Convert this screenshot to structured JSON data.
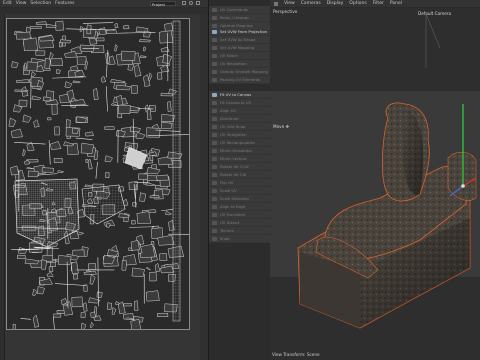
{
  "uv_editor": {
    "menu": [
      "Edit",
      "View",
      "Selection",
      "Features"
    ],
    "texture_select": "Project"
  },
  "commands": {
    "group1": [
      {
        "label": "UV Commands",
        "active": false
      },
      {
        "label": "Relax / Unwrap",
        "active": false
      },
      {
        "label": "Optimal Mapping",
        "active": false
      }
    ],
    "group2": [
      {
        "label": "Set UVW From Projection",
        "active": true
      },
      {
        "label": "Set UVW As Shape",
        "active": false
      },
      {
        "label": "Set UVW Mapping",
        "active": false
      },
      {
        "label": "UV Stitch",
        "active": false
      },
      {
        "label": "UV Relaxation",
        "active": false
      },
      {
        "label": "Unwrap Smooth Mapping",
        "active": false
      },
      {
        "label": "Packing UV Elements",
        "active": false
      }
    ],
    "group3": [
      {
        "label": "Fit UV to Canvas",
        "active": true
      },
      {
        "label": "Fit Canvas to UV",
        "active": false
      },
      {
        "label": "Align UV",
        "active": false
      },
      {
        "label": "Distribute",
        "active": false
      },
      {
        "label": "UV Grid Snap",
        "active": false
      },
      {
        "label": "UV Straighten",
        "active": false
      },
      {
        "label": "UV Rectangularize",
        "active": false
      },
      {
        "label": "Mirror Horizontal",
        "active": false
      },
      {
        "label": "Mirror Vertical",
        "active": false
      },
      {
        "label": "Rotate 90 CCW",
        "active": false
      },
      {
        "label": "Rotate 90 CW",
        "active": false
      },
      {
        "label": "Flip UV",
        "active": false
      },
      {
        "label": "Scale UV",
        "active": false
      },
      {
        "label": "Scale Selection",
        "active": false
      },
      {
        "label": "Align to Edge",
        "active": false
      },
      {
        "label": "UV Transform",
        "active": false
      },
      {
        "label": "UV Distort",
        "active": false
      },
      {
        "label": "Terrace",
        "active": false
      },
      {
        "label": "Snap",
        "active": false
      }
    ]
  },
  "viewport": {
    "menu": [
      "View",
      "Cameras",
      "Display",
      "Options",
      "Filter",
      "Panel"
    ],
    "view_name": "Perspective",
    "camera_name": "Default Camera",
    "side_label": "Move ✥",
    "footer": "View Transform: Scene"
  },
  "colors": {
    "accent": "#d9632a",
    "axis_y": "#2ecc40",
    "axis_x": "#e03030",
    "axis_z": "#3a6fe0"
  }
}
